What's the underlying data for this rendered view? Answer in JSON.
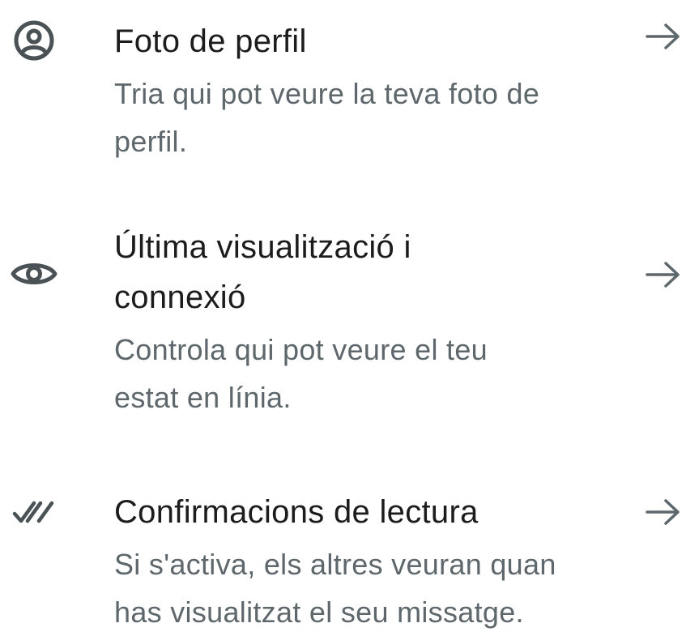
{
  "privacy_items": [
    {
      "title": "Foto de perfil",
      "description": "Tria qui pot veure la teva foto de perfil.",
      "icon": "profile-circle-icon"
    },
    {
      "title": "Última visualització i connexió",
      "description": "Controla qui pot veure el teu estat en línia.",
      "icon": "eye-icon"
    },
    {
      "title": "Confirmacions de lectura",
      "description": "Si s'activa, els altres veuran quan has visualitzat el seu missatge.",
      "icon": "double-check-icon"
    }
  ],
  "colors": {
    "title": "#1c1c1c",
    "description": "#5e676c",
    "icon": "#4a5256",
    "background": "#ffffff"
  }
}
